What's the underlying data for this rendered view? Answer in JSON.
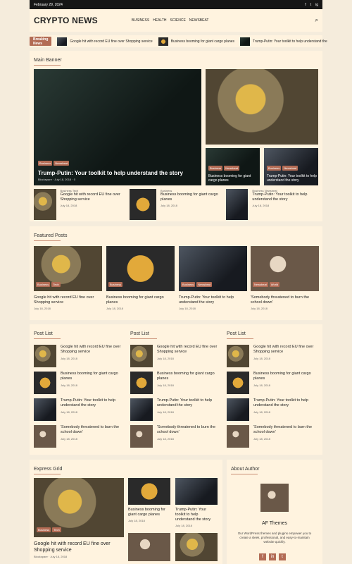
{
  "topbar": {
    "date": "February 29, 2024",
    "social": [
      "f",
      "t",
      "ig"
    ]
  },
  "header": {
    "logo": "CRYPTO NEWS",
    "nav": [
      "BUSINESS",
      "HEALTH",
      "SCIENCE",
      "NEWSBEAT"
    ]
  },
  "ticker": {
    "label": "Breaking News",
    "items": [
      "Google hit with record EU fine over Shopping service",
      "Business booming for giant cargo planes",
      "Trump-Putin: Your toolkit to help understand the"
    ]
  },
  "main_banner": {
    "title": "Main Banner",
    "hero": {
      "tags": [
        "Business",
        "Newsbeat"
      ],
      "headline": "Trump-Putin: Your toolkit to help understand the story",
      "author": "Blockspare",
      "date": "July 18, 2018",
      "comments": "0"
    },
    "side_small": [
      {
        "tags": [
          "Business",
          "Newsbeat"
        ],
        "title": "Business booming for giant cargo planes"
      },
      {
        "tags": [
          "Business",
          "Newsbeat"
        ],
        "title": "Trump-Putin: Your toolkit to help understand the story"
      }
    ],
    "row": [
      {
        "cats": [
          "Business",
          "Tech"
        ],
        "title": "Google hit with record EU fine over Shopping service",
        "date": "July 18, 2018"
      },
      {
        "cats": [
          "Business"
        ],
        "title": "Business booming for giant cargo planes",
        "date": "July 18, 2018"
      },
      {
        "cats": [
          "Business",
          "Newsbeat"
        ],
        "title": "Trump-Putin: Your toolkit to help understand the story",
        "date": "July 18, 2018"
      }
    ]
  },
  "featured": {
    "title": "Featured Posts",
    "items": [
      {
        "tags": [
          "Business",
          "Tech"
        ],
        "title": "Google hit with record EU fine over Shopping service",
        "date": "July 18, 2018"
      },
      {
        "tags": [
          "Business"
        ],
        "title": "Business booming for giant cargo planes",
        "date": "July 18, 2018"
      },
      {
        "tags": [
          "Business",
          "Newsbeat"
        ],
        "title": "Trump-Putin: Your toolkit to help understand the story",
        "date": "July 18, 2018"
      },
      {
        "tags": [
          "Newsbeat",
          "World"
        ],
        "title": "'Somebody threatened to burn the school down'",
        "date": "July 18, 2018"
      }
    ]
  },
  "post_lists": {
    "title": "Post List",
    "items": [
      {
        "title": "Google hit with record EU fine over Shopping service",
        "date": "July 18, 2018"
      },
      {
        "title": "Business booming for giant cargo planes",
        "date": "July 18, 2018"
      },
      {
        "title": "Trump-Putin: Your toolkit to help understand the story",
        "date": "July 18, 2018"
      },
      {
        "title": "'Somebody threatened to burn the school down'",
        "date": "July 18, 2018"
      }
    ]
  },
  "express_grid": {
    "title": "Express Grid",
    "main": {
      "tags": [
        "Business",
        "Tech"
      ],
      "title": "Google hit with record EU fine over Shopping service",
      "author": "Blockspare",
      "date": "July 18, 2018"
    },
    "small": [
      {
        "title": "Business booming for giant cargo planes",
        "date": "July 18, 2018"
      },
      {
        "title": "Trump-Putin: Your toolkit to help understand the story",
        "date": "July 18, 2018"
      }
    ]
  },
  "about": {
    "title": "About Author",
    "name": "AF Themes",
    "desc": "Our WordPress themes and plugins empower you to create a sleek, professional, and easy-to-maintain website quickly.",
    "social": [
      "f",
      "in",
      "t"
    ]
  }
}
